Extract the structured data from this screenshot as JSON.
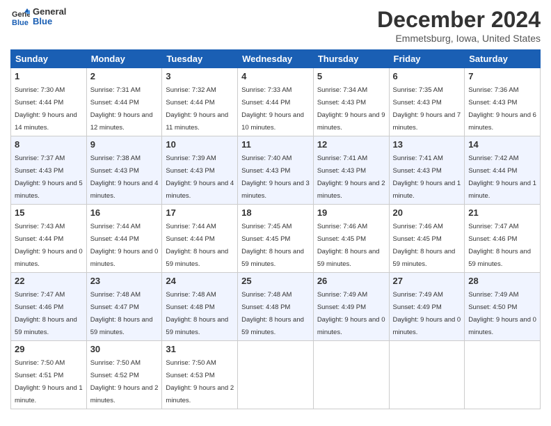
{
  "logo": {
    "line1": "General",
    "line2": "Blue"
  },
  "title": "December 2024",
  "location": "Emmetsburg, Iowa, United States",
  "weekdays": [
    "Sunday",
    "Monday",
    "Tuesday",
    "Wednesday",
    "Thursday",
    "Friday",
    "Saturday"
  ],
  "weeks": [
    [
      {
        "day": "1",
        "sunrise": "Sunrise: 7:30 AM",
        "sunset": "Sunset: 4:44 PM",
        "daylight": "Daylight: 9 hours and 14 minutes."
      },
      {
        "day": "2",
        "sunrise": "Sunrise: 7:31 AM",
        "sunset": "Sunset: 4:44 PM",
        "daylight": "Daylight: 9 hours and 12 minutes."
      },
      {
        "day": "3",
        "sunrise": "Sunrise: 7:32 AM",
        "sunset": "Sunset: 4:44 PM",
        "daylight": "Daylight: 9 hours and 11 minutes."
      },
      {
        "day": "4",
        "sunrise": "Sunrise: 7:33 AM",
        "sunset": "Sunset: 4:44 PM",
        "daylight": "Daylight: 9 hours and 10 minutes."
      },
      {
        "day": "5",
        "sunrise": "Sunrise: 7:34 AM",
        "sunset": "Sunset: 4:43 PM",
        "daylight": "Daylight: 9 hours and 9 minutes."
      },
      {
        "day": "6",
        "sunrise": "Sunrise: 7:35 AM",
        "sunset": "Sunset: 4:43 PM",
        "daylight": "Daylight: 9 hours and 7 minutes."
      },
      {
        "day": "7",
        "sunrise": "Sunrise: 7:36 AM",
        "sunset": "Sunset: 4:43 PM",
        "daylight": "Daylight: 9 hours and 6 minutes."
      }
    ],
    [
      {
        "day": "8",
        "sunrise": "Sunrise: 7:37 AM",
        "sunset": "Sunset: 4:43 PM",
        "daylight": "Daylight: 9 hours and 5 minutes."
      },
      {
        "day": "9",
        "sunrise": "Sunrise: 7:38 AM",
        "sunset": "Sunset: 4:43 PM",
        "daylight": "Daylight: 9 hours and 4 minutes."
      },
      {
        "day": "10",
        "sunrise": "Sunrise: 7:39 AM",
        "sunset": "Sunset: 4:43 PM",
        "daylight": "Daylight: 9 hours and 4 minutes."
      },
      {
        "day": "11",
        "sunrise": "Sunrise: 7:40 AM",
        "sunset": "Sunset: 4:43 PM",
        "daylight": "Daylight: 9 hours and 3 minutes."
      },
      {
        "day": "12",
        "sunrise": "Sunrise: 7:41 AM",
        "sunset": "Sunset: 4:43 PM",
        "daylight": "Daylight: 9 hours and 2 minutes."
      },
      {
        "day": "13",
        "sunrise": "Sunrise: 7:41 AM",
        "sunset": "Sunset: 4:43 PM",
        "daylight": "Daylight: 9 hours and 1 minute."
      },
      {
        "day": "14",
        "sunrise": "Sunrise: 7:42 AM",
        "sunset": "Sunset: 4:44 PM",
        "daylight": "Daylight: 9 hours and 1 minute."
      }
    ],
    [
      {
        "day": "15",
        "sunrise": "Sunrise: 7:43 AM",
        "sunset": "Sunset: 4:44 PM",
        "daylight": "Daylight: 9 hours and 0 minutes."
      },
      {
        "day": "16",
        "sunrise": "Sunrise: 7:44 AM",
        "sunset": "Sunset: 4:44 PM",
        "daylight": "Daylight: 9 hours and 0 minutes."
      },
      {
        "day": "17",
        "sunrise": "Sunrise: 7:44 AM",
        "sunset": "Sunset: 4:44 PM",
        "daylight": "Daylight: 8 hours and 59 minutes."
      },
      {
        "day": "18",
        "sunrise": "Sunrise: 7:45 AM",
        "sunset": "Sunset: 4:45 PM",
        "daylight": "Daylight: 8 hours and 59 minutes."
      },
      {
        "day": "19",
        "sunrise": "Sunrise: 7:46 AM",
        "sunset": "Sunset: 4:45 PM",
        "daylight": "Daylight: 8 hours and 59 minutes."
      },
      {
        "day": "20",
        "sunrise": "Sunrise: 7:46 AM",
        "sunset": "Sunset: 4:45 PM",
        "daylight": "Daylight: 8 hours and 59 minutes."
      },
      {
        "day": "21",
        "sunrise": "Sunrise: 7:47 AM",
        "sunset": "Sunset: 4:46 PM",
        "daylight": "Daylight: 8 hours and 59 minutes."
      }
    ],
    [
      {
        "day": "22",
        "sunrise": "Sunrise: 7:47 AM",
        "sunset": "Sunset: 4:46 PM",
        "daylight": "Daylight: 8 hours and 59 minutes."
      },
      {
        "day": "23",
        "sunrise": "Sunrise: 7:48 AM",
        "sunset": "Sunset: 4:47 PM",
        "daylight": "Daylight: 8 hours and 59 minutes."
      },
      {
        "day": "24",
        "sunrise": "Sunrise: 7:48 AM",
        "sunset": "Sunset: 4:48 PM",
        "daylight": "Daylight: 8 hours and 59 minutes."
      },
      {
        "day": "25",
        "sunrise": "Sunrise: 7:48 AM",
        "sunset": "Sunset: 4:48 PM",
        "daylight": "Daylight: 8 hours and 59 minutes."
      },
      {
        "day": "26",
        "sunrise": "Sunrise: 7:49 AM",
        "sunset": "Sunset: 4:49 PM",
        "daylight": "Daylight: 9 hours and 0 minutes."
      },
      {
        "day": "27",
        "sunrise": "Sunrise: 7:49 AM",
        "sunset": "Sunset: 4:49 PM",
        "daylight": "Daylight: 9 hours and 0 minutes."
      },
      {
        "day": "28",
        "sunrise": "Sunrise: 7:49 AM",
        "sunset": "Sunset: 4:50 PM",
        "daylight": "Daylight: 9 hours and 0 minutes."
      }
    ],
    [
      {
        "day": "29",
        "sunrise": "Sunrise: 7:50 AM",
        "sunset": "Sunset: 4:51 PM",
        "daylight": "Daylight: 9 hours and 1 minute."
      },
      {
        "day": "30",
        "sunrise": "Sunrise: 7:50 AM",
        "sunset": "Sunset: 4:52 PM",
        "daylight": "Daylight: 9 hours and 2 minutes."
      },
      {
        "day": "31",
        "sunrise": "Sunrise: 7:50 AM",
        "sunset": "Sunset: 4:53 PM",
        "daylight": "Daylight: 9 hours and 2 minutes."
      },
      null,
      null,
      null,
      null
    ]
  ]
}
